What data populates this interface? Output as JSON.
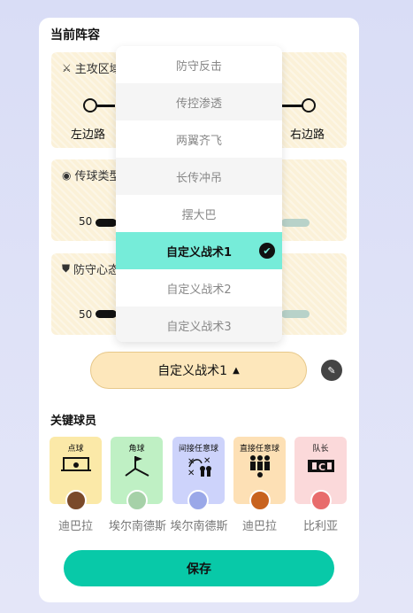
{
  "lineup": {
    "title": "当前阵容",
    "attack_zone": {
      "label": "主攻区域",
      "left": "左边路",
      "right": "右边路",
      "icon": "swords-icon"
    },
    "passing": {
      "label": "传球类型",
      "left_value": "50",
      "icon": "target-icon"
    },
    "defense": {
      "label": "防守心态",
      "left_value": "50",
      "icon": "shield-icon"
    }
  },
  "tactics_menu": {
    "options": [
      "防守反击",
      "传控渗透",
      "两翼齐飞",
      "长传冲吊",
      "摆大巴",
      "自定义战术1",
      "自定义战术2",
      "自定义战术3"
    ],
    "selected_index": 5
  },
  "tactic_select": {
    "value": "自定义战术1",
    "arrow": "▲"
  },
  "key_players": {
    "title": "关键球员",
    "roles": [
      {
        "role": "点球",
        "name": "迪巴拉",
        "color": "#fbe9a8",
        "icon": "penalty-goal-icon"
      },
      {
        "role": "角球",
        "name": "埃尔南德斯",
        "color": "#bff0c4",
        "icon": "corner-flag-icon"
      },
      {
        "role": "间接任意球",
        "name": "埃尔南德斯",
        "color": "#cdd3fb",
        "icon": "tactic-board-icon"
      },
      {
        "role": "直接任意球",
        "name": "迪巴拉",
        "color": "#fde0b5",
        "icon": "free-kick-wall-icon"
      },
      {
        "role": "队长",
        "name": "比利亚",
        "color": "#fbd9da",
        "icon": "captain-armband-icon"
      }
    ]
  },
  "save_label": "保存",
  "colors": {
    "accent": "#08c9a8",
    "selected": "#76ecd9",
    "panel": "#fbf1d8"
  }
}
